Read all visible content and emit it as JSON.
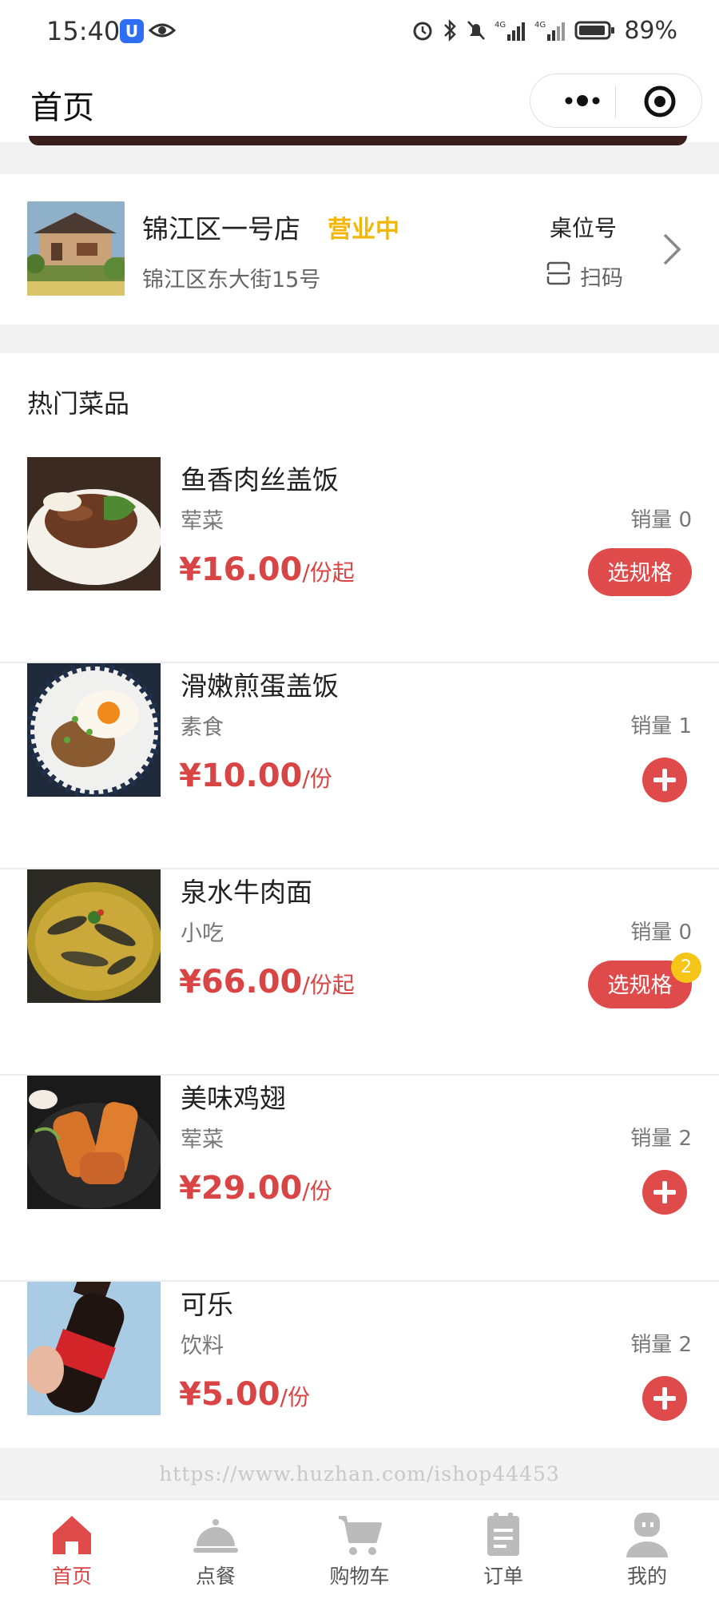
{
  "status_bar": {
    "time": "15:40",
    "battery": "89%"
  },
  "nav": {
    "title": "首页"
  },
  "store": {
    "name": "锦江区一号店",
    "status": "营业中",
    "address": "锦江区东大街15号",
    "table_label": "桌位号",
    "scan_label": "扫码"
  },
  "hot": {
    "title": "热门菜品",
    "dishes": [
      {
        "name": "鱼香肉丝盖饭",
        "category": "荤菜",
        "sales": "销量 0",
        "price": "¥16.00",
        "unit": "/份起",
        "action": "选规格"
      },
      {
        "name": "滑嫩煎蛋盖饭",
        "category": "素食",
        "sales": "销量 1",
        "price": "¥10.00",
        "unit": "/份",
        "action": "+"
      },
      {
        "name": "泉水牛肉面",
        "category": "小吃",
        "sales": "销量 0",
        "price": "¥66.00",
        "unit": "/份起",
        "action": "选规格",
        "badge": "2"
      },
      {
        "name": "美味鸡翅",
        "category": "荤菜",
        "sales": "销量 2",
        "price": "¥29.00",
        "unit": "/份",
        "action": "+"
      },
      {
        "name": "可乐",
        "category": "饮料",
        "sales": "销量 2",
        "price": "¥5.00",
        "unit": "/份",
        "action": "+"
      }
    ]
  },
  "watermark": "https://www.huzhan.com/ishop44453",
  "tabs": [
    {
      "label": "首页",
      "icon": "home-icon",
      "active": true
    },
    {
      "label": "点餐",
      "icon": "dish-cover-icon"
    },
    {
      "label": "购物车",
      "icon": "cart-icon"
    },
    {
      "label": "订单",
      "icon": "order-icon"
    },
    {
      "label": "我的",
      "icon": "profile-icon"
    }
  ],
  "colors": {
    "accent": "#df4a4a",
    "store_status": "#f2b705",
    "badge": "#f5c518"
  }
}
